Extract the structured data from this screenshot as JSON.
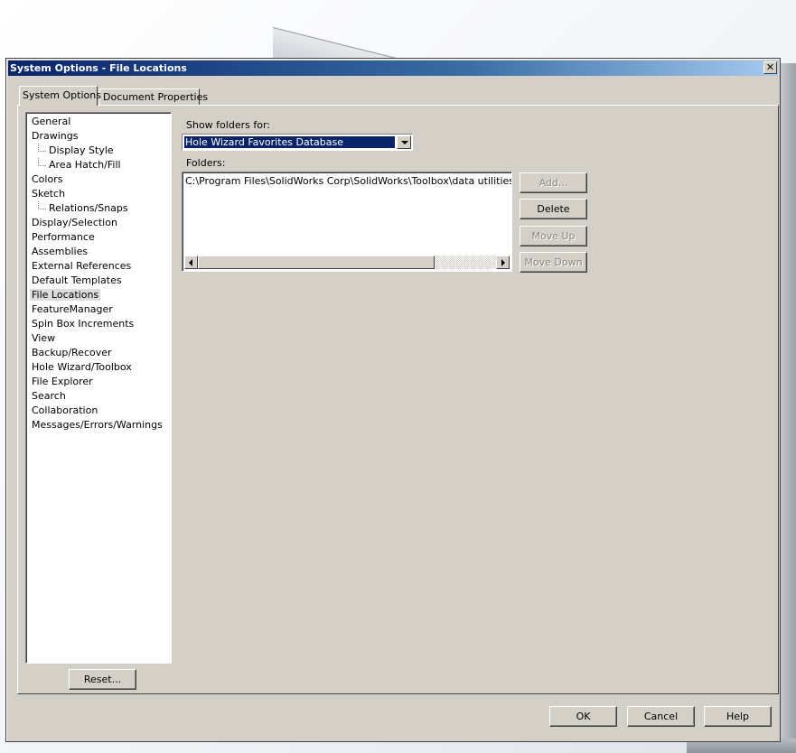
{
  "window": {
    "title": "System Options - File Locations",
    "close_glyph": "✕"
  },
  "tabs": [
    {
      "label": "System Options",
      "active": true
    },
    {
      "label": "Document Properties",
      "active": false
    }
  ],
  "nav": {
    "items": [
      {
        "label": "General"
      },
      {
        "label": "Drawings"
      },
      {
        "label": "Display Style"
      },
      {
        "label": "Area Hatch/Fill"
      },
      {
        "label": "Colors"
      },
      {
        "label": "Sketch"
      },
      {
        "label": "Relations/Snaps"
      },
      {
        "label": "Display/Selection"
      },
      {
        "label": "Performance"
      },
      {
        "label": "Assemblies"
      },
      {
        "label": "External References"
      },
      {
        "label": "Default Templates"
      },
      {
        "label": "File Locations"
      },
      {
        "label": "FeatureManager"
      },
      {
        "label": "Spin Box Increments"
      },
      {
        "label": "View"
      },
      {
        "label": "Backup/Recover"
      },
      {
        "label": "Hole Wizard/Toolbox"
      },
      {
        "label": "File Explorer"
      },
      {
        "label": "Search"
      },
      {
        "label": "Collaboration"
      },
      {
        "label": "Messages/Errors/Warnings"
      }
    ],
    "selected": "File Locations",
    "reset_label": "Reset..."
  },
  "file_locations": {
    "show_folders_label": "Show folders for:",
    "show_folders_value": "Hole Wizard Favorites Database",
    "folders_label": "Folders:",
    "folders": [
      "C:\\Program Files\\SolidWorks Corp\\SolidWorks\\Toolbox\\data utilities\\lang\\English"
    ],
    "buttons": {
      "add": "Add...",
      "delete": "Delete",
      "move_up": "Move Up",
      "move_down": "Move Down"
    }
  },
  "footer": {
    "ok": "OK",
    "cancel": "Cancel",
    "help": "Help"
  }
}
